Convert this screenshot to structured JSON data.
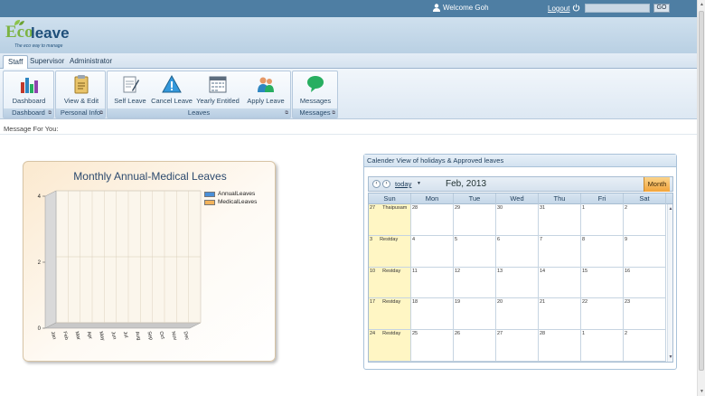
{
  "topbar": {
    "welcome": "Welcome Goh",
    "logout": "Logout",
    "search_value": "",
    "go_label": "GO"
  },
  "logo": {
    "eco": "Eco",
    "leave": "leave",
    "tagline": "The eco way to manage"
  },
  "tabs": [
    "Staff",
    "Supervisor",
    "Administrator"
  ],
  "ribbon": {
    "groups": [
      {
        "label": "Dashboard",
        "buttons": [
          {
            "label": "Dashboard",
            "icon": "bar-chart-icon"
          }
        ]
      },
      {
        "label": "Personal Info",
        "buttons": [
          {
            "label": "View & Edit",
            "icon": "clipboard-icon"
          }
        ]
      },
      {
        "label": "Leaves",
        "buttons": [
          {
            "label": "Self Leave",
            "icon": "document-edit-icon"
          },
          {
            "label": "Cancel Leave",
            "icon": "warning-icon"
          },
          {
            "label": "Yearly Entitled",
            "icon": "calendar-icon"
          },
          {
            "label": "Apply Leave",
            "icon": "users-icon"
          }
        ]
      },
      {
        "label": "Messages",
        "buttons": [
          {
            "label": "Messages",
            "icon": "speech-bubble-icon"
          }
        ]
      }
    ]
  },
  "message_for_you": "Message For You:",
  "chart_panel": {
    "title": "Monthly Annual-Medical Leaves"
  },
  "chart_data": {
    "type": "bar",
    "title": "Monthly Annual-Medical Leaves",
    "categories": [
      "Jan",
      "Feb",
      "Mar",
      "Apr",
      "May",
      "Jun",
      "Jul",
      "Aug",
      "Sep",
      "Oct",
      "Nov",
      "Dec"
    ],
    "series": [
      {
        "name": "AnnualLeaves",
        "values": [
          0,
          0,
          0,
          0,
          0,
          0,
          0,
          0,
          0,
          0,
          0,
          0
        ],
        "color": "#4a90d9"
      },
      {
        "name": "MedicalLeaves",
        "values": [
          0,
          0,
          0,
          0,
          0,
          0,
          0,
          0,
          0,
          0,
          0,
          0
        ],
        "color": "#f2b35c"
      }
    ],
    "yticks": [
      0,
      2,
      4
    ],
    "ylim": [
      0,
      4
    ],
    "legend": "top-right",
    "grid": true
  },
  "calendar": {
    "panel_title": "Calender View of holidays & Approved leaves",
    "today_label": "today",
    "month_title": "Feb, 2013",
    "view_button": "Month",
    "weekdays": [
      "Sun",
      "Mon",
      "Tue",
      "Wed",
      "Thu",
      "Fri",
      "Sat"
    ],
    "weeks": [
      [
        {
          "d": "27",
          "ev": "Thaipusam"
        },
        {
          "d": "28"
        },
        {
          "d": "29"
        },
        {
          "d": "30"
        },
        {
          "d": "31"
        },
        {
          "d": "1"
        },
        {
          "d": "2"
        }
      ],
      [
        {
          "d": "3",
          "ev": "Restday"
        },
        {
          "d": "4"
        },
        {
          "d": "5"
        },
        {
          "d": "6"
        },
        {
          "d": "7"
        },
        {
          "d": "8"
        },
        {
          "d": "9"
        }
      ],
      [
        {
          "d": "10",
          "ev": "Restday"
        },
        {
          "d": "11"
        },
        {
          "d": "12"
        },
        {
          "d": "13"
        },
        {
          "d": "14"
        },
        {
          "d": "15"
        },
        {
          "d": "16"
        }
      ],
      [
        {
          "d": "17",
          "ev": "Restday"
        },
        {
          "d": "18"
        },
        {
          "d": "19"
        },
        {
          "d": "20"
        },
        {
          "d": "21"
        },
        {
          "d": "22"
        },
        {
          "d": "23"
        }
      ],
      [
        {
          "d": "24",
          "ev": "Restday"
        },
        {
          "d": "25"
        },
        {
          "d": "26"
        },
        {
          "d": "27"
        },
        {
          "d": "28"
        },
        {
          "d": "1"
        },
        {
          "d": "2"
        }
      ]
    ]
  },
  "colors": {
    "topbar": "#4e7ea3",
    "accent_orange": "#f2a43a",
    "sunday_highlight": "#fff6c4"
  }
}
